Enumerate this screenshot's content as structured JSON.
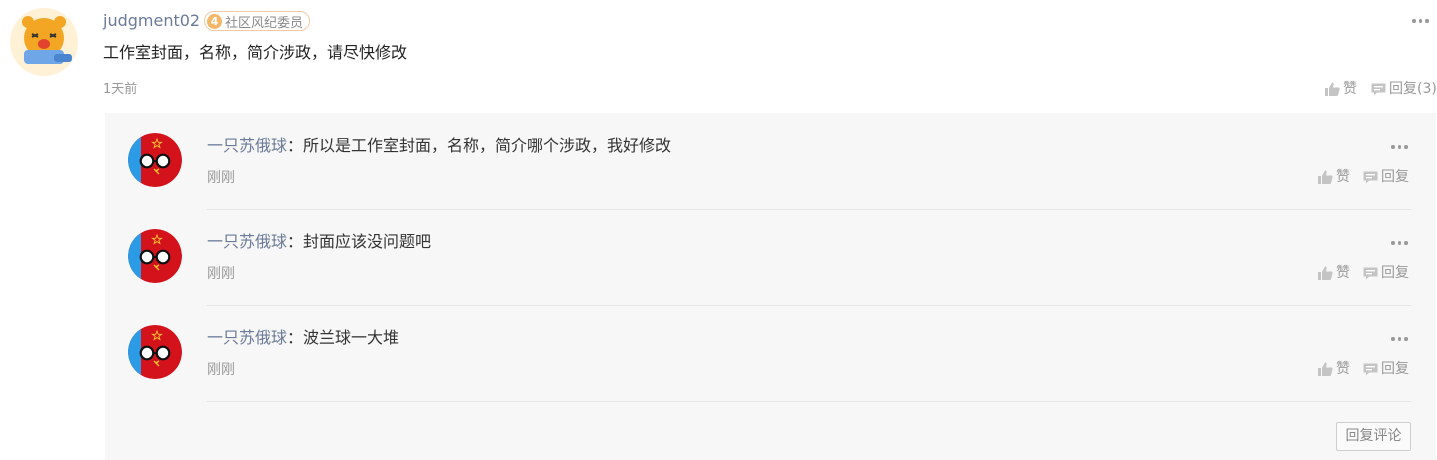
{
  "comment": {
    "username": "judgment02",
    "badge_level": "4",
    "badge_title": "社区风纪委员",
    "text": "工作室封面，名称，简介涉政，请尽快修改",
    "time": "1天前",
    "like_label": "赞",
    "reply_label": "回复(3)"
  },
  "replies": [
    {
      "name": "一只苏俄球",
      "sep": "：",
      "text": "所以是工作室封面，名称，简介哪个涉政，我好修改",
      "time": "刚刚",
      "like_label": "赞",
      "reply_label": "回复"
    },
    {
      "name": "一只苏俄球",
      "sep": "：",
      "text": "封面应该没问题吧",
      "time": "刚刚",
      "like_label": "赞",
      "reply_label": "回复"
    },
    {
      "name": "一只苏俄球",
      "sep": "：",
      "text": "波兰球一大堆",
      "time": "刚刚",
      "like_label": "赞",
      "reply_label": "回复"
    }
  ],
  "reply_comment_button": "回复评论",
  "colors": {
    "name_link": "#6b7a99",
    "panel_bg": "#f7f7f7",
    "badge_orange": "#f4b76a",
    "ball_red": "#d4121c",
    "ball_blue": "#2b9be6"
  }
}
